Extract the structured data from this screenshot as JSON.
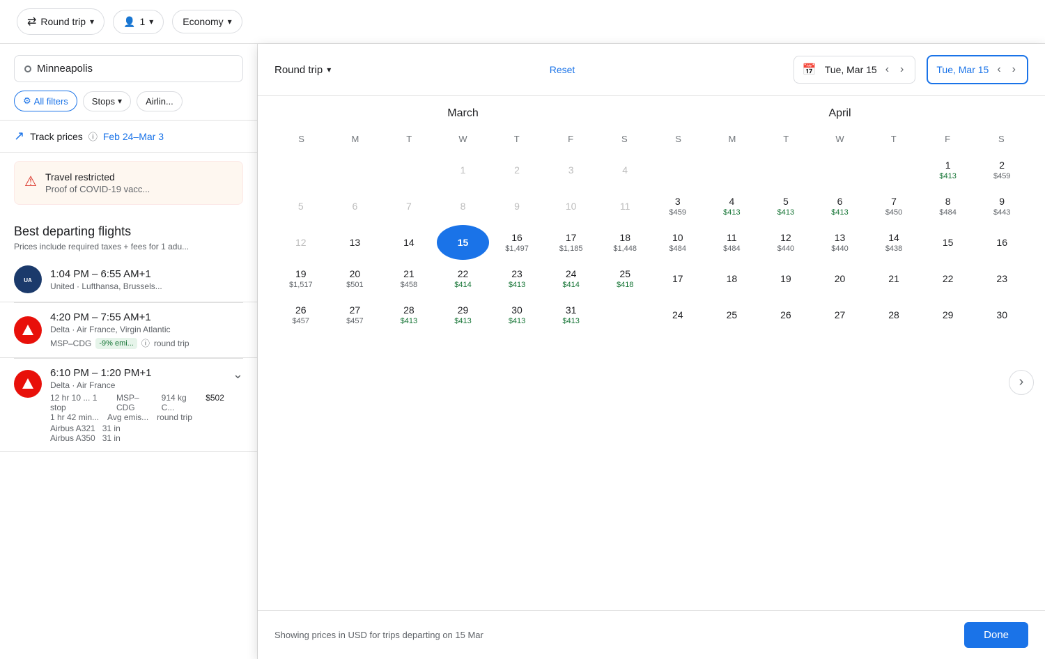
{
  "topbar": {
    "round_trip_label": "Round trip",
    "passengers_label": "1",
    "cabin_label": "Economy"
  },
  "left_panel": {
    "search_city": "Minneapolis",
    "all_filters_label": "All filters",
    "stops_label": "Stops",
    "airlines_label": "Airlin...",
    "track_prices_label": "Track prices",
    "track_prices_date": "Feb 24–Mar 3",
    "restricted_title": "Travel restricted",
    "restricted_sub": "Proof of COVID-19 vacc...",
    "best_departing": "Best departing flights",
    "best_departing_sub": "Prices include required taxes + fees for 1 adu...",
    "flights": [
      {
        "times": "1:04 PM – 6:55 AM+1",
        "airlines": "United · Lufthansa, Brussels...",
        "id": "united"
      },
      {
        "times": "4:20 PM – 7:55 AM+1",
        "airlines": "Delta · Air France, Virgin Atlantic",
        "route": "MSP–CDG",
        "badge": "-9% emi...",
        "trip_type": "round trip",
        "id": "delta1"
      },
      {
        "times": "6:10 PM – 1:20 PM+1",
        "airlines": "Delta · Air France",
        "duration": "12 hr 10 ... 1 stop",
        "duration_sub": "1 hr 42 min...",
        "route": "MSP–CDG",
        "kg": "914 kg C...",
        "avg_emis": "Avg emis...",
        "price": "$502",
        "trip_type": "round trip",
        "aircraft1": "Airbus A321",
        "aircraft2": "Airbus A350",
        "seat1": "31 in",
        "seat2": "31 in",
        "id": "delta2"
      }
    ]
  },
  "calendar": {
    "trip_label": "Round trip",
    "reset_label": "Reset",
    "depart_date": "Tue, Mar 15",
    "return_date": "Tue, Mar 15",
    "done_label": "Done",
    "footer_text": "Showing prices in USD for trips departing on 15 Mar",
    "march": {
      "title": "March",
      "weekdays": [
        "S",
        "M",
        "T",
        "W",
        "T",
        "F",
        "S"
      ],
      "rows": [
        [
          {
            "day": "",
            "price": "",
            "grayed": false,
            "empty": true
          },
          {
            "day": "",
            "price": "",
            "grayed": false,
            "empty": true
          },
          {
            "day": "",
            "price": "",
            "grayed": false,
            "empty": true
          },
          {
            "day": "1",
            "price": "",
            "grayed": true
          },
          {
            "day": "2",
            "price": "",
            "grayed": true
          },
          {
            "day": "3",
            "price": "",
            "grayed": true
          },
          {
            "day": "4",
            "price": "",
            "grayed": true
          }
        ],
        [
          {
            "day": "5",
            "price": "",
            "grayed": true
          },
          {
            "day": "6",
            "price": "",
            "grayed": true
          },
          {
            "day": "7",
            "price": "",
            "grayed": true
          },
          {
            "day": "8",
            "price": "",
            "grayed": true
          },
          {
            "day": "9",
            "price": "",
            "grayed": true
          },
          {
            "day": "10",
            "price": "",
            "grayed": true
          },
          {
            "day": "11",
            "price": "",
            "grayed": true
          }
        ],
        [
          {
            "day": "12",
            "price": "",
            "grayed": true
          },
          {
            "day": "13",
            "price": "",
            "grayed": false
          },
          {
            "day": "14",
            "price": "",
            "grayed": false
          },
          {
            "day": "15",
            "price": "",
            "grayed": false,
            "selected": true
          },
          {
            "day": "16",
            "price": "$1,497",
            "grayed": false
          },
          {
            "day": "17",
            "price": "$1,185",
            "grayed": false
          },
          {
            "day": "18",
            "price": "$1,448",
            "grayed": false
          }
        ],
        [
          {
            "day": "19",
            "price": "$1,517",
            "grayed": false
          },
          {
            "day": "20",
            "price": "$501",
            "grayed": false
          },
          {
            "day": "21",
            "price": "$458",
            "grayed": false
          },
          {
            "day": "22",
            "price": "$414",
            "grayed": false,
            "green": true
          },
          {
            "day": "23",
            "price": "$413",
            "grayed": false,
            "green": true
          },
          {
            "day": "24",
            "price": "$414",
            "grayed": false,
            "green": true
          },
          {
            "day": "25",
            "price": "$418",
            "grayed": false,
            "green": true
          }
        ],
        [
          {
            "day": "26",
            "price": "$457",
            "grayed": false
          },
          {
            "day": "27",
            "price": "$457",
            "grayed": false
          },
          {
            "day": "28",
            "price": "$413",
            "grayed": false,
            "green": true
          },
          {
            "day": "29",
            "price": "$413",
            "grayed": false,
            "green": true
          },
          {
            "day": "30",
            "price": "$413",
            "grayed": false,
            "green": true
          },
          {
            "day": "31",
            "price": "$413",
            "grayed": false,
            "green": true
          },
          {
            "day": "",
            "price": "",
            "empty": true
          }
        ]
      ]
    },
    "april": {
      "title": "April",
      "weekdays": [
        "S",
        "M",
        "T",
        "W",
        "T",
        "F",
        "S"
      ],
      "rows": [
        [
          {
            "day": "",
            "price": "",
            "empty": true
          },
          {
            "day": "",
            "price": "",
            "empty": true
          },
          {
            "day": "",
            "price": "",
            "empty": true
          },
          {
            "day": "",
            "price": "",
            "empty": true
          },
          {
            "day": "",
            "price": "",
            "empty": true
          },
          {
            "day": "1",
            "price": "$413",
            "green": true
          },
          {
            "day": "2",
            "price": "$459"
          }
        ],
        [
          {
            "day": "3",
            "price": "$459"
          },
          {
            "day": "4",
            "price": "$413",
            "green": true
          },
          {
            "day": "5",
            "price": "$413",
            "green": true
          },
          {
            "day": "6",
            "price": "$413",
            "green": true
          },
          {
            "day": "7",
            "price": "$450"
          },
          {
            "day": "8",
            "price": "$484"
          },
          {
            "day": "9",
            "price": "$443"
          }
        ],
        [
          {
            "day": "10",
            "price": "$484"
          },
          {
            "day": "11",
            "price": "$484"
          },
          {
            "day": "12",
            "price": "$440"
          },
          {
            "day": "13",
            "price": "$440"
          },
          {
            "day": "14",
            "price": "$438"
          },
          {
            "day": "15",
            "price": ""
          },
          {
            "day": "16",
            "price": ""
          }
        ],
        [
          {
            "day": "17",
            "price": ""
          },
          {
            "day": "18",
            "price": ""
          },
          {
            "day": "19",
            "price": ""
          },
          {
            "day": "20",
            "price": ""
          },
          {
            "day": "21",
            "price": ""
          },
          {
            "day": "22",
            "price": ""
          },
          {
            "day": "23",
            "price": ""
          }
        ],
        [
          {
            "day": "24",
            "price": ""
          },
          {
            "day": "25",
            "price": ""
          },
          {
            "day": "26",
            "price": ""
          },
          {
            "day": "27",
            "price": ""
          },
          {
            "day": "28",
            "price": ""
          },
          {
            "day": "29",
            "price": ""
          },
          {
            "day": "30",
            "price": ""
          }
        ]
      ]
    }
  }
}
